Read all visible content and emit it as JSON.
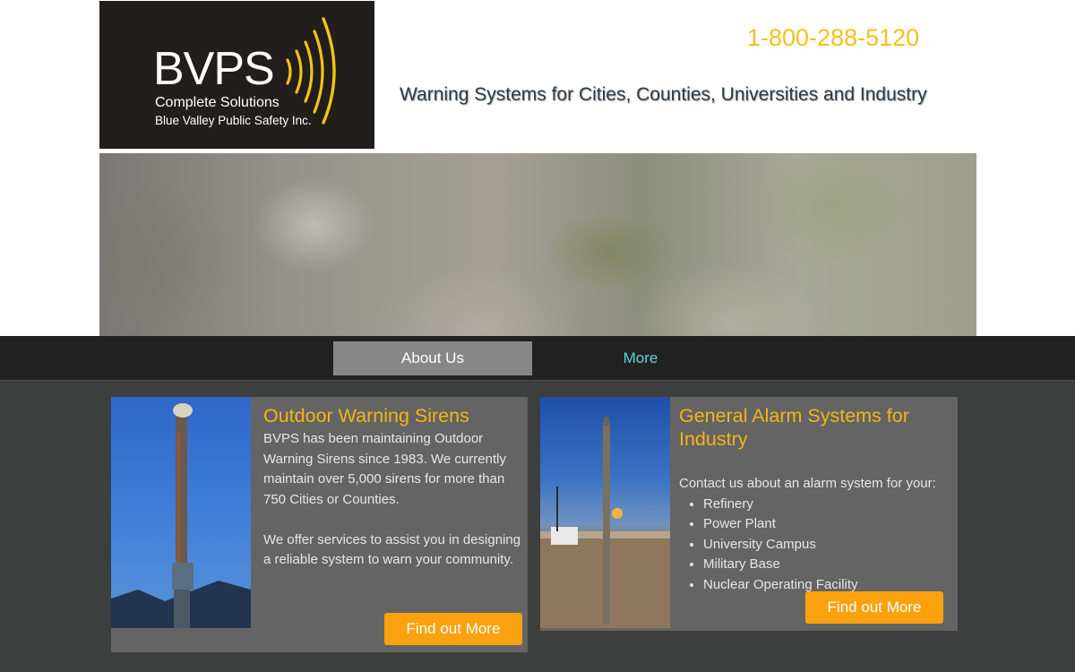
{
  "header": {
    "logo": {
      "brand": "BVPS",
      "line1": "Complete Solutions",
      "line2": "Blue Valley Public Safety Inc.",
      "icon": "sound-waves-icon"
    },
    "phone": "1-800-288-5120",
    "tagline": "Warning Systems for Cities, Counties, Universities and Industry"
  },
  "nav": {
    "items": [
      {
        "label": "About Us",
        "selected": true
      },
      {
        "label": "More",
        "selected": false
      }
    ]
  },
  "cards": [
    {
      "title": "Outdoor Warning Sirens",
      "paragraphs": [
        "BVPS has been maintaining Outdoor Warning Sirens since 1983. We currently maintain over 5,000 sirens for more than 750 Cities or Counties.",
        "We offer services to assist you in designing a reliable system to warn your community."
      ],
      "button": "Find out More"
    },
    {
      "title": "General Alarm Systems for Industry",
      "intro": "Contact us about an alarm system for your:",
      "list": [
        "Refinery",
        "Power Plant",
        "University Campus",
        "Military Base",
        "Nuclear Operating Facility"
      ],
      "button": "Find out More"
    }
  ],
  "colors": {
    "accent": "#f5b415",
    "button": "#f9a20e",
    "nav_link": "#5fd3dc",
    "phone": "#f5c018",
    "background": "#3d3e3e"
  }
}
